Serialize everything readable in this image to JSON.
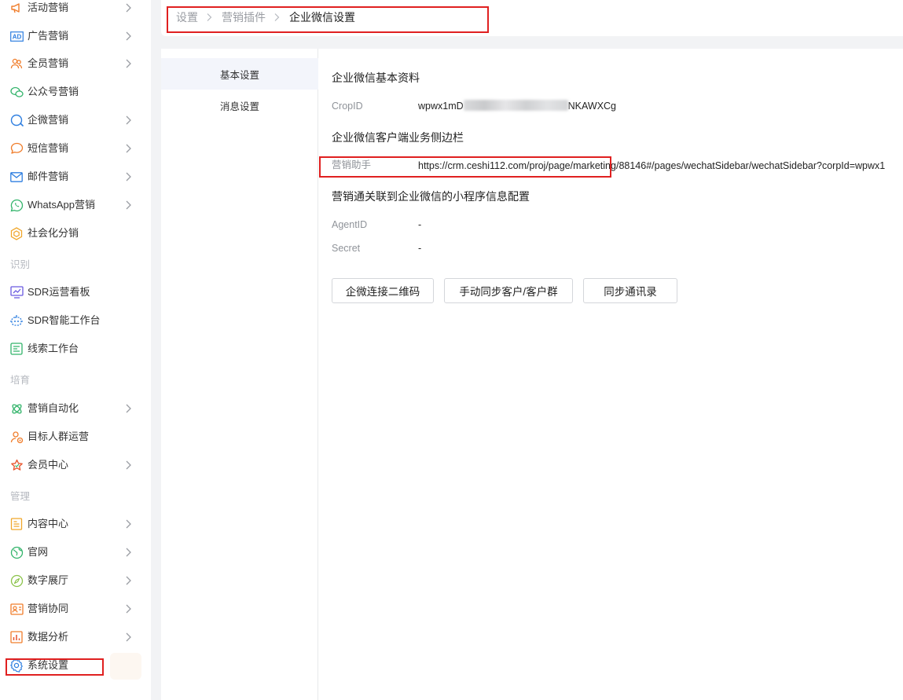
{
  "sidebar": {
    "groups": {
      "recognize": "识别",
      "nurture": "培育",
      "manage": "管理"
    },
    "items": [
      {
        "label": "活动营销",
        "icon": "megaphone-icon"
      },
      {
        "label": "广告营销",
        "icon": "ad-icon",
        "icon_text": "AD"
      },
      {
        "label": "全员营销",
        "icon": "people-icon"
      },
      {
        "label": "公众号营销",
        "icon": "wechat-icon"
      },
      {
        "label": "企微营销",
        "icon": "chat-bubble-icon"
      },
      {
        "label": "短信营销",
        "icon": "message-icon"
      },
      {
        "label": "邮件营销",
        "icon": "mail-icon"
      },
      {
        "label": "WhatsApp营销",
        "icon": "whatsapp-icon"
      },
      {
        "label": "社会化分销",
        "icon": "hexagon-icon"
      },
      {
        "label": "SDR运营看板",
        "icon": "dashboard-icon"
      },
      {
        "label": "SDR智能工作台",
        "icon": "robot-icon"
      },
      {
        "label": "线索工作台",
        "icon": "clue-icon"
      },
      {
        "label": "营销自动化",
        "icon": "atom-icon"
      },
      {
        "label": "目标人群运营",
        "icon": "target-people-icon"
      },
      {
        "label": "会员中心",
        "icon": "star-icon"
      },
      {
        "label": "内容中心",
        "icon": "document-icon"
      },
      {
        "label": "官网",
        "icon": "globe-icon"
      },
      {
        "label": "数字展厅",
        "icon": "compass-icon"
      },
      {
        "label": "营销协同",
        "icon": "id-card-icon"
      },
      {
        "label": "数据分析",
        "icon": "chart-icon"
      },
      {
        "label": "系统设置",
        "icon": "settings-icon"
      }
    ]
  },
  "breadcrumb": {
    "items": [
      "设置",
      "营销插件",
      "企业微信设置"
    ]
  },
  "subnav": {
    "items": [
      "基本设置",
      "消息设置"
    ]
  },
  "main": {
    "section1_title": "企业微信基本资料",
    "crop_id_label": "CropID",
    "crop_id_prefix": "wpwx1mD",
    "crop_id_suffix": "NKAWXCg",
    "section2_title": "企业微信客户端业务侧边栏",
    "assistant_label": "营销助手",
    "assistant_url": "https://crm.ceshi112.com/proj/page/marketing/88146#/pages/wechatSidebar/wechatSidebar?corpId=wpwx1",
    "section3_title": "营销通关联到企业微信的小程序信息配置",
    "agent_id_label": "AgentID",
    "agent_id_value": "-",
    "secret_label": "Secret",
    "secret_value": "-",
    "buttons": [
      "企微连接二维码",
      "手动同步客户/客户群",
      "同步通讯录"
    ]
  },
  "colors": {
    "highlight_box": "#e02020",
    "icon_orange": "#f07d2b",
    "icon_blue": "#2f7fe0",
    "icon_green": "#33b46b"
  }
}
